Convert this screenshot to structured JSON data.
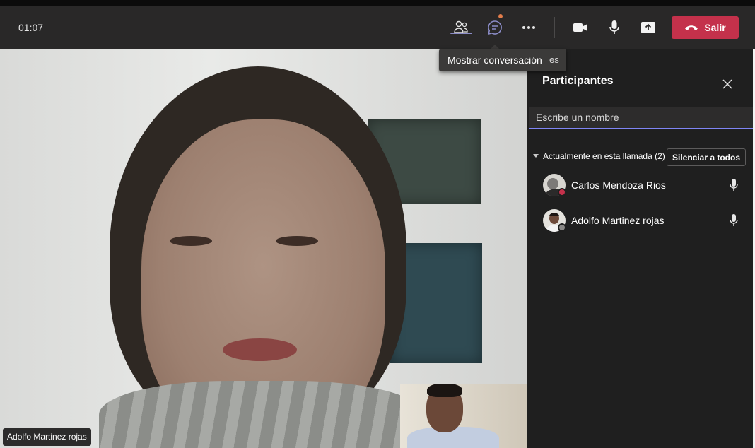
{
  "call": {
    "timer": "01:07",
    "leave_label": "Salir"
  },
  "toolbar_icons": [
    "people-icon",
    "chat-icon",
    "more-icon",
    "camera-icon",
    "microphone-icon",
    "share-screen-icon",
    "hang-up-icon"
  ],
  "tooltip": {
    "text": "Mostrar conversación",
    "tail_text": "es"
  },
  "main_video": {
    "name_tag": "Adolfo Martinez rojas"
  },
  "participants_panel": {
    "title": "Participantes",
    "search_placeholder": "Escribe un nombre",
    "section_label": "Actualmente en esta llamada (2)",
    "mute_all_label": "Silenciar a todos",
    "participants": [
      {
        "name": "Carlos Mendoza Rios",
        "status_color": "#c4314b"
      },
      {
        "name": "Adolfo Martinez rojas",
        "status_color": "#8a8886"
      }
    ]
  },
  "colors": {
    "toolbar_bg": "#292828",
    "leave_red": "#c4314b",
    "accent": "#7f85f5",
    "panel_bg": "#1f1f1f"
  }
}
